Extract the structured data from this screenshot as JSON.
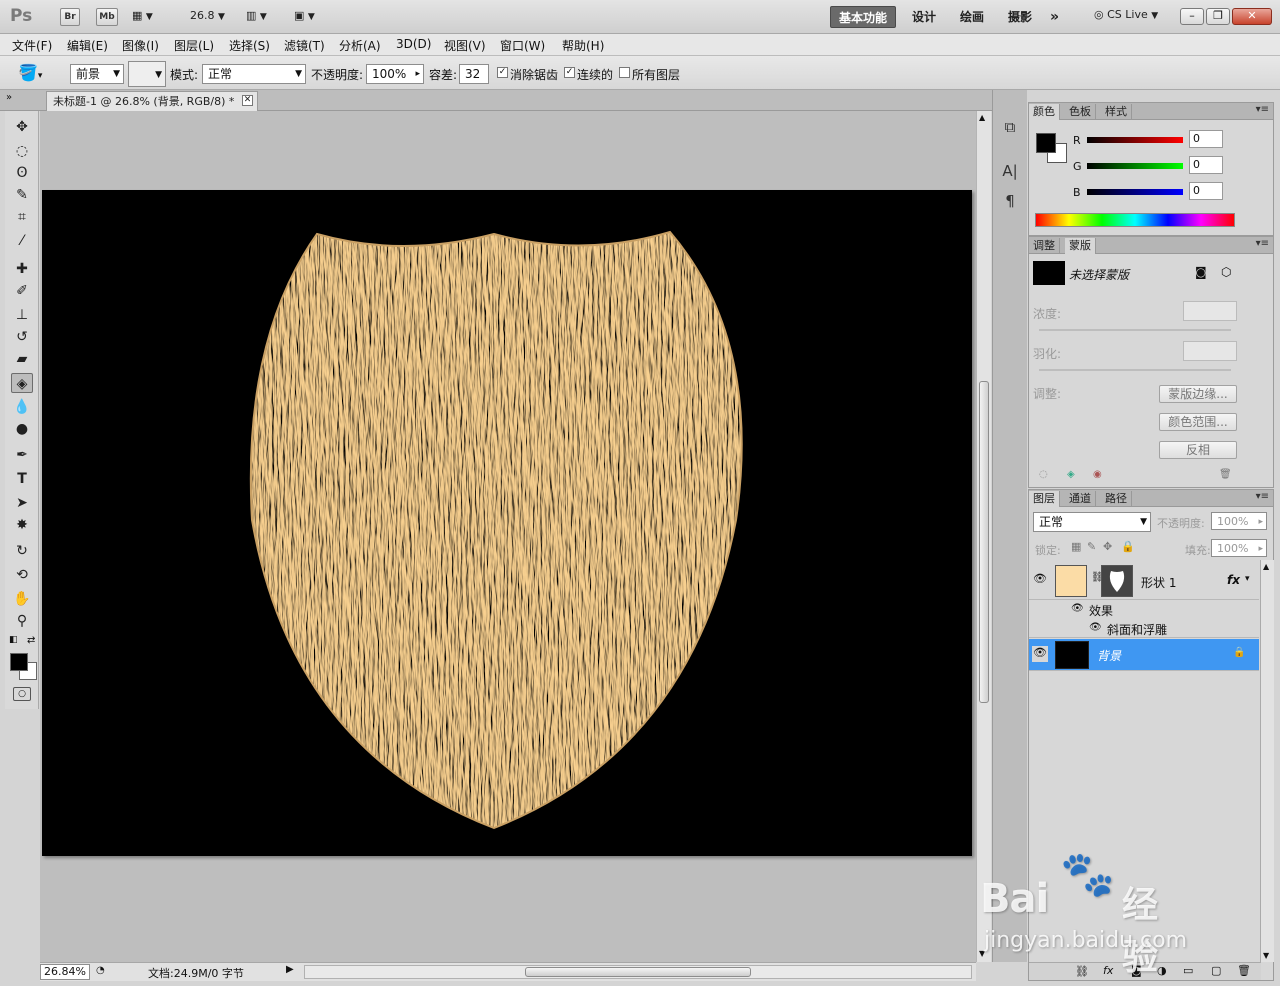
{
  "app": {
    "logo": "Ps",
    "bridge_label": "Br",
    "minibridge_label": "Mb",
    "zoom_dropdown": "26.8",
    "workspaces": [
      "基本功能",
      "设计",
      "绘画",
      "摄影"
    ],
    "more_workspaces": "»",
    "cs_live": "CS Live"
  },
  "menu": [
    "文件(F)",
    "编辑(E)",
    "图像(I)",
    "图层(L)",
    "选择(S)",
    "滤镜(T)",
    "分析(A)",
    "3D(D)",
    "视图(V)",
    "窗口(W)",
    "帮助(H)"
  ],
  "options": {
    "fill_source": "前景",
    "mode_label": "模式:",
    "mode_value": "正常",
    "opacity_label": "不透明度:",
    "opacity_value": "100%",
    "tolerance_label": "容差:",
    "tolerance_value": "32",
    "antialias_label": "消除锯齿",
    "contiguous_label": "连续的",
    "all_layers_label": "所有图层"
  },
  "document": {
    "tab_title": "未标题-1 @ 26.8% (背景, RGB/8) *"
  },
  "status": {
    "zoom": "26.84%",
    "doc_info": "文档:24.9M/0 字节"
  },
  "color_panel": {
    "tabs": [
      "颜色",
      "色板",
      "样式"
    ],
    "r_label": "R",
    "g_label": "G",
    "b_label": "B",
    "r_value": "0",
    "g_value": "0",
    "b_value": "0"
  },
  "masks_panel": {
    "tabs": [
      "调整",
      "蒙版"
    ],
    "no_mask": "未选择蒙版",
    "density_label": "浓度:",
    "feather_label": "羽化:",
    "refine_label": "调整:",
    "mask_edge_button": "蒙版边缘...",
    "color_range_button": "颜色范围...",
    "invert_button": "反相"
  },
  "layers_panel": {
    "tabs": [
      "图层",
      "通道",
      "路径"
    ],
    "blend_mode": "正常",
    "opacity_label": "不透明度:",
    "opacity_value": "100%",
    "lock_label": "锁定:",
    "fill_label": "填充:",
    "fill_value": "100%",
    "layers": [
      {
        "name": "形状 1",
        "fx": "fx"
      },
      {
        "name": "背景"
      }
    ],
    "effects_label": "效果",
    "bevel_label": "斜面和浮雕"
  },
  "watermark": {
    "brand": "Bai",
    "brand_cn": "经验",
    "url": "jingyan.baidu.com"
  },
  "colors": {
    "shield_fill": "#f2cb8c",
    "layer_selected": "#3f97f2",
    "shape_swatch": "#fbdca6"
  }
}
